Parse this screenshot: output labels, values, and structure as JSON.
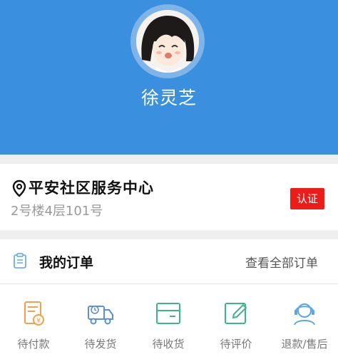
{
  "profile": {
    "name": "徐灵芝"
  },
  "address": {
    "title": "平安社区服务中心",
    "detail": "2号楼4层101号",
    "badge": "认证"
  },
  "orders": {
    "title": "我的订单",
    "view_all": "查看全部订单",
    "statuses": [
      {
        "label": "待付款",
        "icon": "wallet-icon",
        "color": "#f2a04a"
      },
      {
        "label": "待发货",
        "icon": "truck-icon",
        "color": "#5b8fd9"
      },
      {
        "label": "待收货",
        "icon": "package-icon",
        "color": "#3bb58c"
      },
      {
        "label": "待评价",
        "icon": "edit-icon",
        "color": "#3bb58c"
      },
      {
        "label": "退款/售后",
        "icon": "customer-service-icon",
        "color": "#5aa6e6"
      }
    ]
  },
  "colors": {
    "header_bg": "#3a8fde",
    "badge_bg": "#ee1b1b"
  }
}
